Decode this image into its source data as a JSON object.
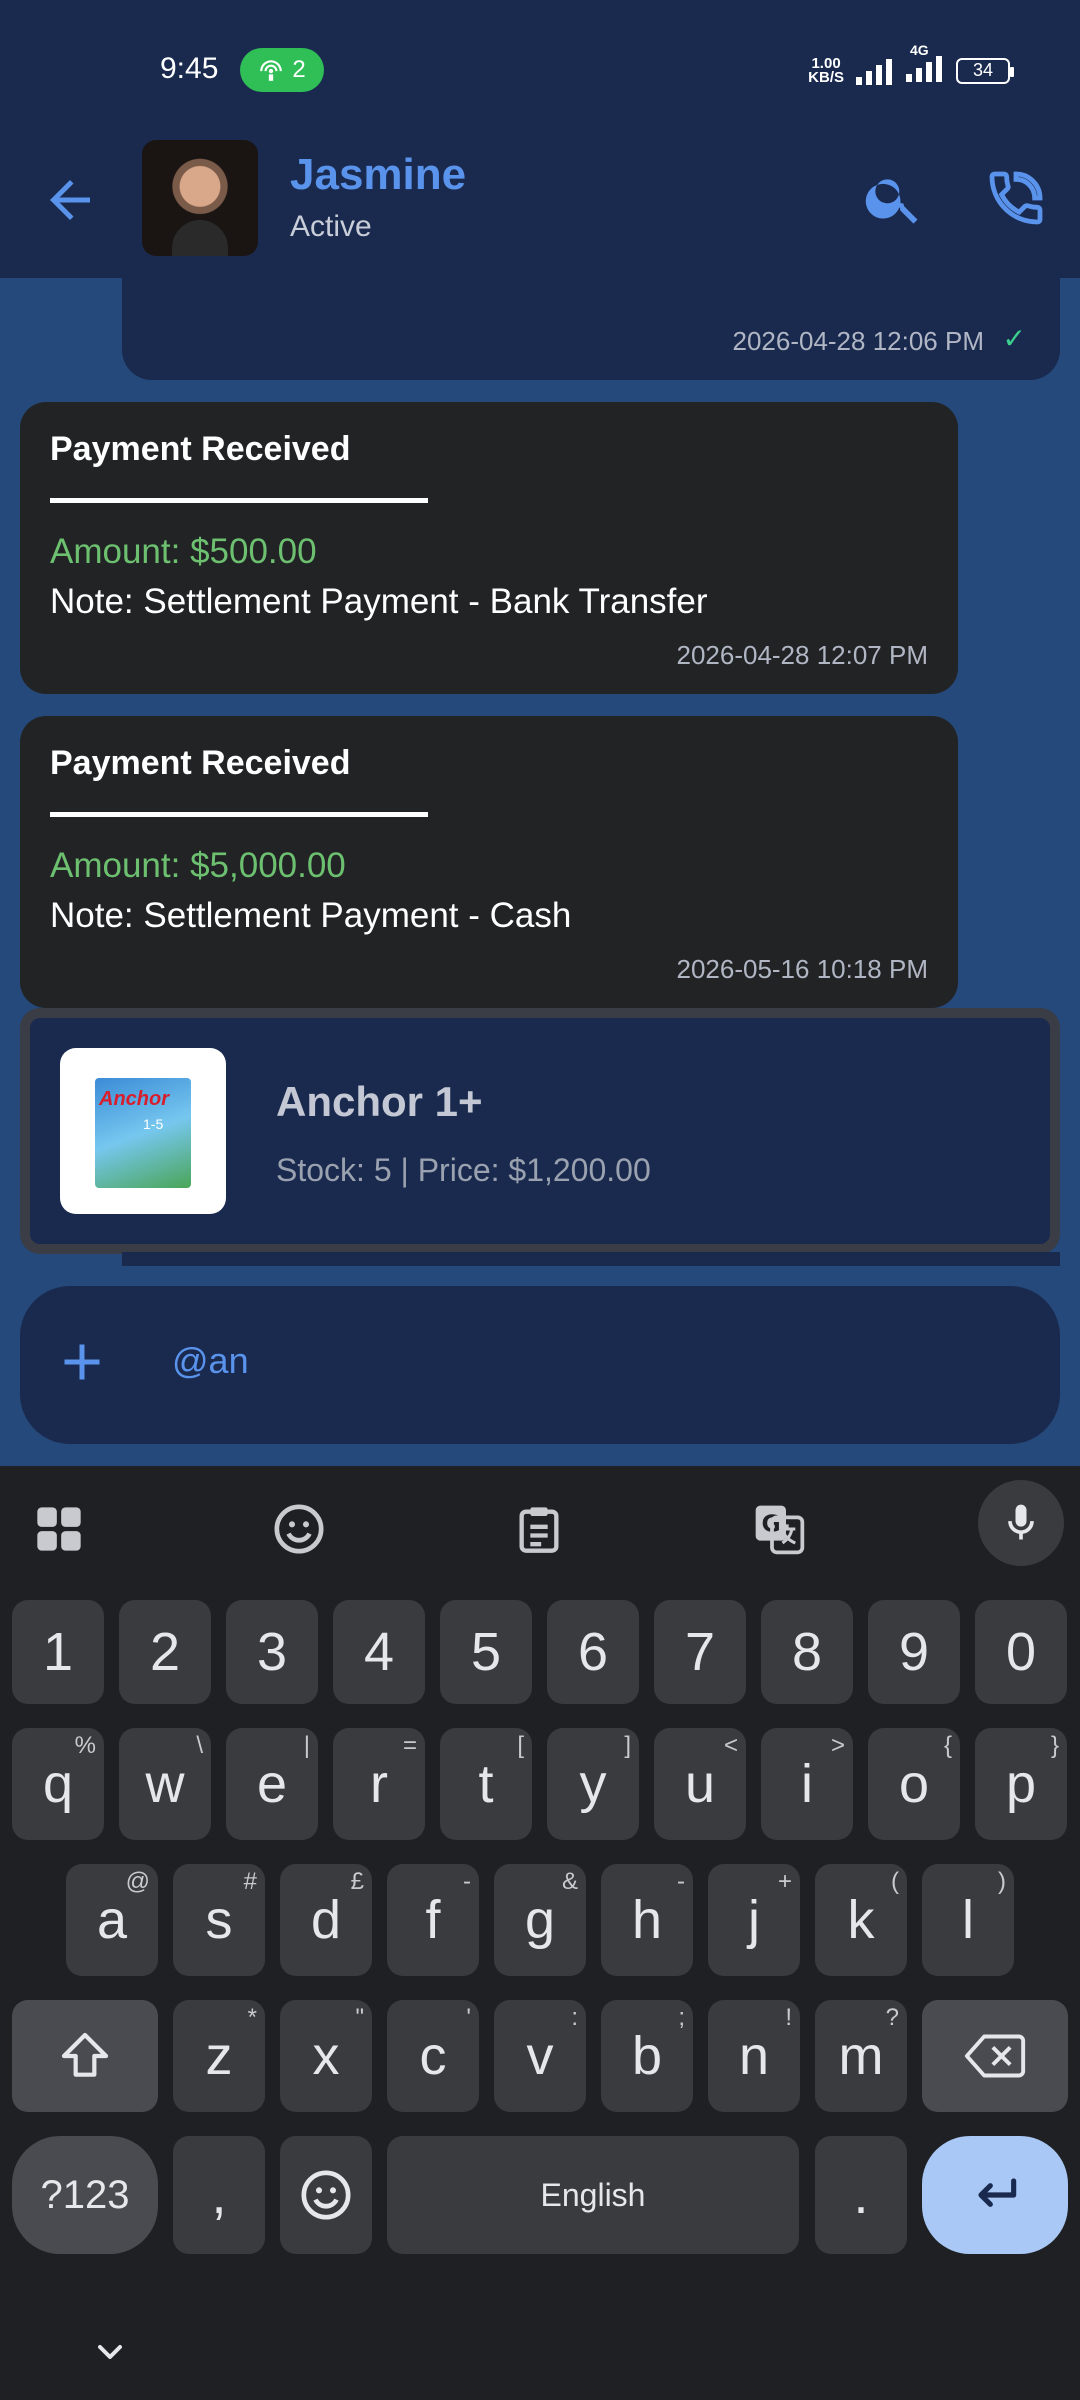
{
  "status_bar": {
    "time": "9:45",
    "hotspot_count": "2",
    "net_speed_value": "1.00",
    "net_speed_unit": "KB/S",
    "network_type": "4G",
    "battery": "34"
  },
  "header": {
    "name": "Jasmine",
    "status": "Active"
  },
  "messages": {
    "prev_timestamp": "2026-04-28 12:06 PM",
    "payments": [
      {
        "title": "Payment Received",
        "amount": "Amount: $500.00",
        "note": "Note: Settlement Payment - Bank Transfer",
        "timestamp": "2026-04-28 12:07 PM"
      },
      {
        "title": "Payment Received",
        "amount": "Amount: $5,000.00",
        "note": "Note: Settlement Payment - Cash",
        "timestamp": "2026-05-16 10:18 PM"
      }
    ]
  },
  "suggestion": {
    "product_name": "Anchor 1+",
    "product_meta": "Stock: 5 | Price: $1,200.00",
    "box_label": "Anchor",
    "box_sub": "1-5"
  },
  "composer": {
    "text": "@an"
  },
  "keyboard": {
    "number_row": [
      "1",
      "2",
      "3",
      "4",
      "5",
      "6",
      "7",
      "8",
      "9",
      "0"
    ],
    "row1": [
      {
        "k": "q",
        "h": "%"
      },
      {
        "k": "w",
        "h": "\\"
      },
      {
        "k": "e",
        "h": "|"
      },
      {
        "k": "r",
        "h": "="
      },
      {
        "k": "t",
        "h": "["
      },
      {
        "k": "y",
        "h": "]"
      },
      {
        "k": "u",
        "h": "<"
      },
      {
        "k": "i",
        "h": ">"
      },
      {
        "k": "o",
        "h": "{"
      },
      {
        "k": "p",
        "h": "}"
      }
    ],
    "row2": [
      {
        "k": "a",
        "h": "@"
      },
      {
        "k": "s",
        "h": "#"
      },
      {
        "k": "d",
        "h": "£"
      },
      {
        "k": "f",
        "h": "-"
      },
      {
        "k": "g",
        "h": "&"
      },
      {
        "k": "h",
        "h": "-"
      },
      {
        "k": "j",
        "h": "+"
      },
      {
        "k": "k",
        "h": "("
      },
      {
        "k": "l",
        "h": ")"
      }
    ],
    "row3": [
      {
        "k": "z",
        "h": "*"
      },
      {
        "k": "x",
        "h": "\""
      },
      {
        "k": "c",
        "h": "'"
      },
      {
        "k": "v",
        "h": ":"
      },
      {
        "k": "b",
        "h": ";"
      },
      {
        "k": "n",
        "h": "!"
      },
      {
        "k": "m",
        "h": "?"
      }
    ],
    "sym_label": "?123",
    "comma": ",",
    "space_label": "English",
    "period": "."
  },
  "colors": {
    "accent": "#5a93ec",
    "header_bg": "#1a2a4f",
    "chat_bg": "#24497a",
    "amount_green": "#6cc070"
  }
}
